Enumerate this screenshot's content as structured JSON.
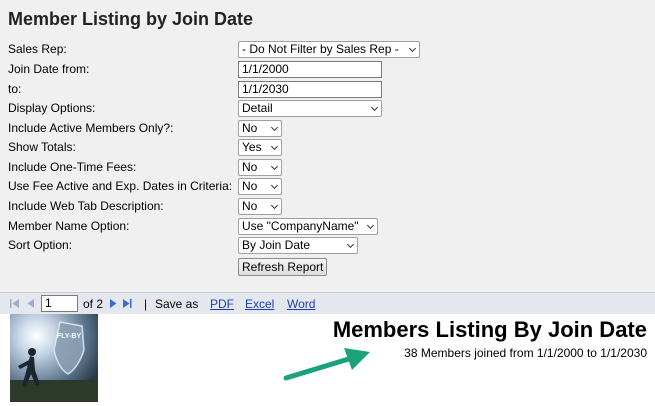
{
  "page": {
    "title": "Member Listing by Join Date"
  },
  "form": {
    "sales_rep": {
      "label": "Sales Rep:",
      "value": "- Do Not Filter by Sales Rep -"
    },
    "join_date_from": {
      "label": "Join Date from:",
      "value": "1/1/2000"
    },
    "join_date_to": {
      "label": "to:",
      "value": "1/1/2030"
    },
    "display_options": {
      "label": "Display Options:",
      "value": "Detail"
    },
    "active_only": {
      "label": "Include Active Members Only?:",
      "value": "No"
    },
    "show_totals": {
      "label": "Show Totals:",
      "value": "Yes"
    },
    "one_time_fees": {
      "label": "Include One-Time Fees:",
      "value": "No"
    },
    "fee_dates": {
      "label": "Use Fee Active and Exp. Dates in Criteria:",
      "value": "No"
    },
    "web_tab": {
      "label": "Include Web Tab Description:",
      "value": "No"
    },
    "name_option": {
      "label": "Member Name Option:",
      "value": "Use \"CompanyName\""
    },
    "sort_option": {
      "label": "Sort Option:",
      "value": "By Join Date"
    },
    "refresh_label": "Refresh Report"
  },
  "toolbar": {
    "current_page": "1",
    "of_pages": "of 2",
    "separator": "|",
    "save_as": "Save as",
    "pdf": "PDF",
    "excel": "Excel",
    "word": "Word"
  },
  "report": {
    "title": "Members Listing By Join Date",
    "subtitle": "38 Members joined from 1/1/2000 to 1/1/2030",
    "logo_text": "FLY-BY"
  },
  "colors": {
    "arrow": "#1aa37a",
    "link": "#1a3fb5"
  },
  "icons": [
    "first-page-icon",
    "previous-page-icon",
    "next-page-icon",
    "last-page-icon",
    "annotation-arrow-icon"
  ]
}
